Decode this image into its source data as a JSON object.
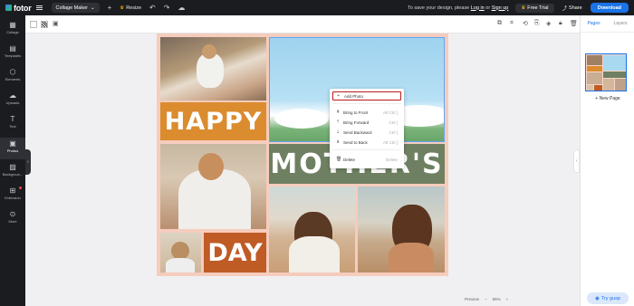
{
  "topbar": {
    "logo": "fotor",
    "mode": "Collage Maker",
    "resize": "Resize",
    "save_message_prefix": "To save your design, please",
    "login": "Log in",
    "or": "or",
    "signup": "Sign up",
    "free_trial": "Free Trial",
    "share": "Share",
    "download": "Download"
  },
  "leftnav": [
    {
      "label": "Collage"
    },
    {
      "label": "Templates"
    },
    {
      "label": "Elements"
    },
    {
      "label": "Uploads"
    },
    {
      "label": "Text"
    },
    {
      "label": "Photos"
    },
    {
      "label": "Backgroun..."
    },
    {
      "label": "Extension"
    },
    {
      "label": "More"
    }
  ],
  "rightpanel": {
    "tabs": [
      "Pages",
      "Layers"
    ],
    "new_page": "+ New Page"
  },
  "canvas": {
    "happy": "HAPPY",
    "mothers": "MOTHER'S",
    "day": "DAY"
  },
  "context_menu": [
    {
      "label": "Add Photo",
      "shortcut": ""
    },
    {
      "label": "Bring to Front",
      "shortcut": "Alt Ctrl ]"
    },
    {
      "label": "Bring Forward",
      "shortcut": "Ctrl ]"
    },
    {
      "label": "Send Backward",
      "shortcut": "Ctrl ["
    },
    {
      "label": "Send to Back",
      "shortcut": "Alt Ctrl ["
    },
    {
      "label": "Delete",
      "shortcut": "Delete"
    }
  ],
  "zoom": {
    "preview": "Preview",
    "minus": "−",
    "level": "55%",
    "plus": "+"
  },
  "help": "Try gusp"
}
